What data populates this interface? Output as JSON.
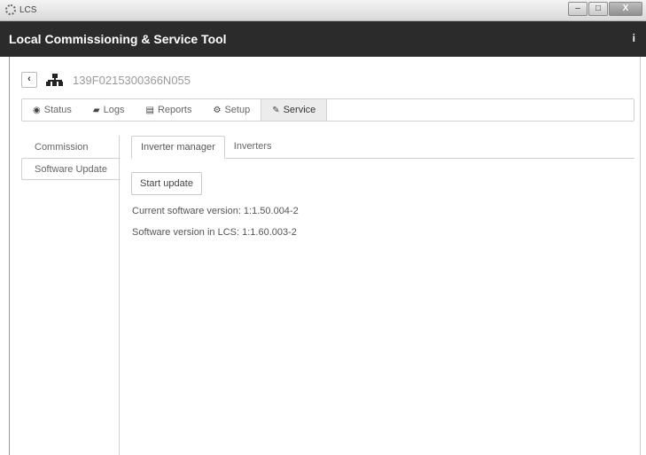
{
  "window": {
    "title": "LCS",
    "controls": [
      "–",
      "□",
      "X"
    ]
  },
  "app": {
    "title": "Local Commissioning & Service Tool",
    "info_label": "i"
  },
  "device": {
    "back_label": "‹",
    "id": "139F0215300366N055"
  },
  "main_tabs": [
    {
      "label": "Status",
      "icon": "eye-icon",
      "glyph": "◉"
    },
    {
      "label": "Logs",
      "icon": "book-icon",
      "glyph": "▰"
    },
    {
      "label": "Reports",
      "icon": "report-icon",
      "glyph": "▤"
    },
    {
      "label": "Setup",
      "icon": "gears-icon",
      "glyph": "⚙"
    },
    {
      "label": "Service",
      "icon": "wrench-icon",
      "glyph": "✎"
    }
  ],
  "sidebar": {
    "items": [
      {
        "label": "Commission"
      },
      {
        "label": "Software Update"
      }
    ]
  },
  "sub_tabs": [
    {
      "label": "Inverter manager"
    },
    {
      "label": "Inverters"
    }
  ],
  "software": {
    "start_label": "Start update",
    "current_version": "Current software version: 1:1.50.004-2",
    "lcs_version": "Software version in LCS: 1:1.60.003-2"
  },
  "colors": {
    "header": "#2b2b2b",
    "active_tab": "#ececec",
    "border": "#d0d0d0"
  }
}
